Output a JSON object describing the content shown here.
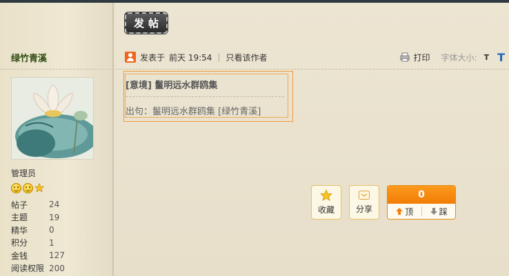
{
  "toolbar": {
    "post_button_label": "发帖"
  },
  "author": {
    "name": "绿竹青溪",
    "role": "管理员",
    "stats": [
      {
        "label": "帖子",
        "value": "24"
      },
      {
        "label": "主题",
        "value": "19"
      },
      {
        "label": "精华",
        "value": "0"
      },
      {
        "label": "积分",
        "value": "1"
      },
      {
        "label": "金钱",
        "value": "127"
      },
      {
        "label": "阅读权限",
        "value": "200"
      }
    ]
  },
  "post_meta": {
    "posted_prefix": "发表于",
    "posted_time": "前天 19:54",
    "separator": "|",
    "only_author": "只看该作者",
    "print_label": "打印",
    "font_size_label": "字体大小:",
    "font_small": "T",
    "font_large": "T"
  },
  "post": {
    "title": "[意境] 鬣明远水群鸥集",
    "content": "出句：鬣明远水群鸥集 [绿竹青溪]"
  },
  "actions": {
    "favorite_label": "收藏",
    "share_label": "分享",
    "vote_count": "0",
    "vote_up_label": "顶",
    "vote_down_label": "踩"
  },
  "colors": {
    "accent_orange": "#f27d06",
    "author_name": "#2d4a12",
    "font_large_blue": "#2266bb"
  }
}
